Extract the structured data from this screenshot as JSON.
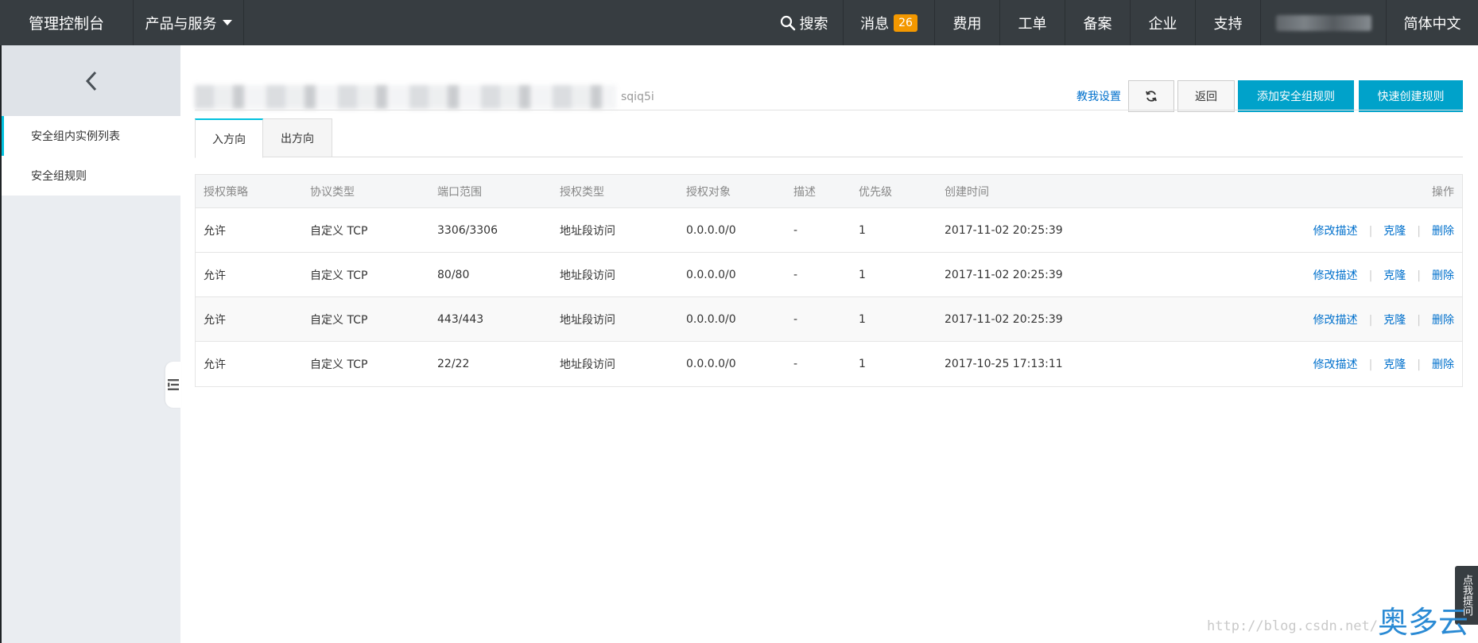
{
  "topbar": {
    "brand": "管理控制台",
    "products": "产品与服务",
    "search": "搜索",
    "messages": "消息",
    "messages_count": "26",
    "billing": "费用",
    "tickets": "工单",
    "icp": "备案",
    "enterprise": "企业",
    "support": "支持",
    "language": "简体中文"
  },
  "sidebar": {
    "items": [
      {
        "label": "安全组内实例列表"
      },
      {
        "label": "安全组规则"
      }
    ]
  },
  "header": {
    "title_suffix": "sqiq5i",
    "help_link": "教我设置",
    "back_button": "返回",
    "add_rule_button": "添加安全组规则",
    "quick_create_button": "快速创建规则"
  },
  "tabs": [
    {
      "label": "入方向"
    },
    {
      "label": "出方向"
    }
  ],
  "table": {
    "headers": [
      "授权策略",
      "协议类型",
      "端口范围",
      "授权类型",
      "授权对象",
      "描述",
      "优先级",
      "创建时间",
      "操作"
    ],
    "rows": [
      [
        "允许",
        "自定义 TCP",
        "3306/3306",
        "地址段访问",
        "0.0.0.0/0",
        "-",
        "1",
        "2017-11-02 20:25:39"
      ],
      [
        "允许",
        "自定义 TCP",
        "80/80",
        "地址段访问",
        "0.0.0.0/0",
        "-",
        "1",
        "2017-11-02 20:25:39"
      ],
      [
        "允许",
        "自定义 TCP",
        "443/443",
        "地址段访问",
        "0.0.0.0/0",
        "-",
        "1",
        "2017-11-02 20:25:39"
      ],
      [
        "允许",
        "自定义 TCP",
        "22/22",
        "地址段访问",
        "0.0.0.0/0",
        "-",
        "1",
        "2017-10-25 17:13:11"
      ]
    ],
    "ops": {
      "edit": "修改描述",
      "clone": "克隆",
      "delete": "删除",
      "sep": "|"
    }
  },
  "floating": {
    "hint": "点我提问",
    "watermark_url": "http://blog.csdn.net/",
    "watermark_logo": "奥多云"
  },
  "colors": {
    "topbar": "#373d41",
    "primary": "#00a2ca",
    "link": "#0070cc",
    "badge": "#f39800",
    "accent": "#00c1de"
  }
}
